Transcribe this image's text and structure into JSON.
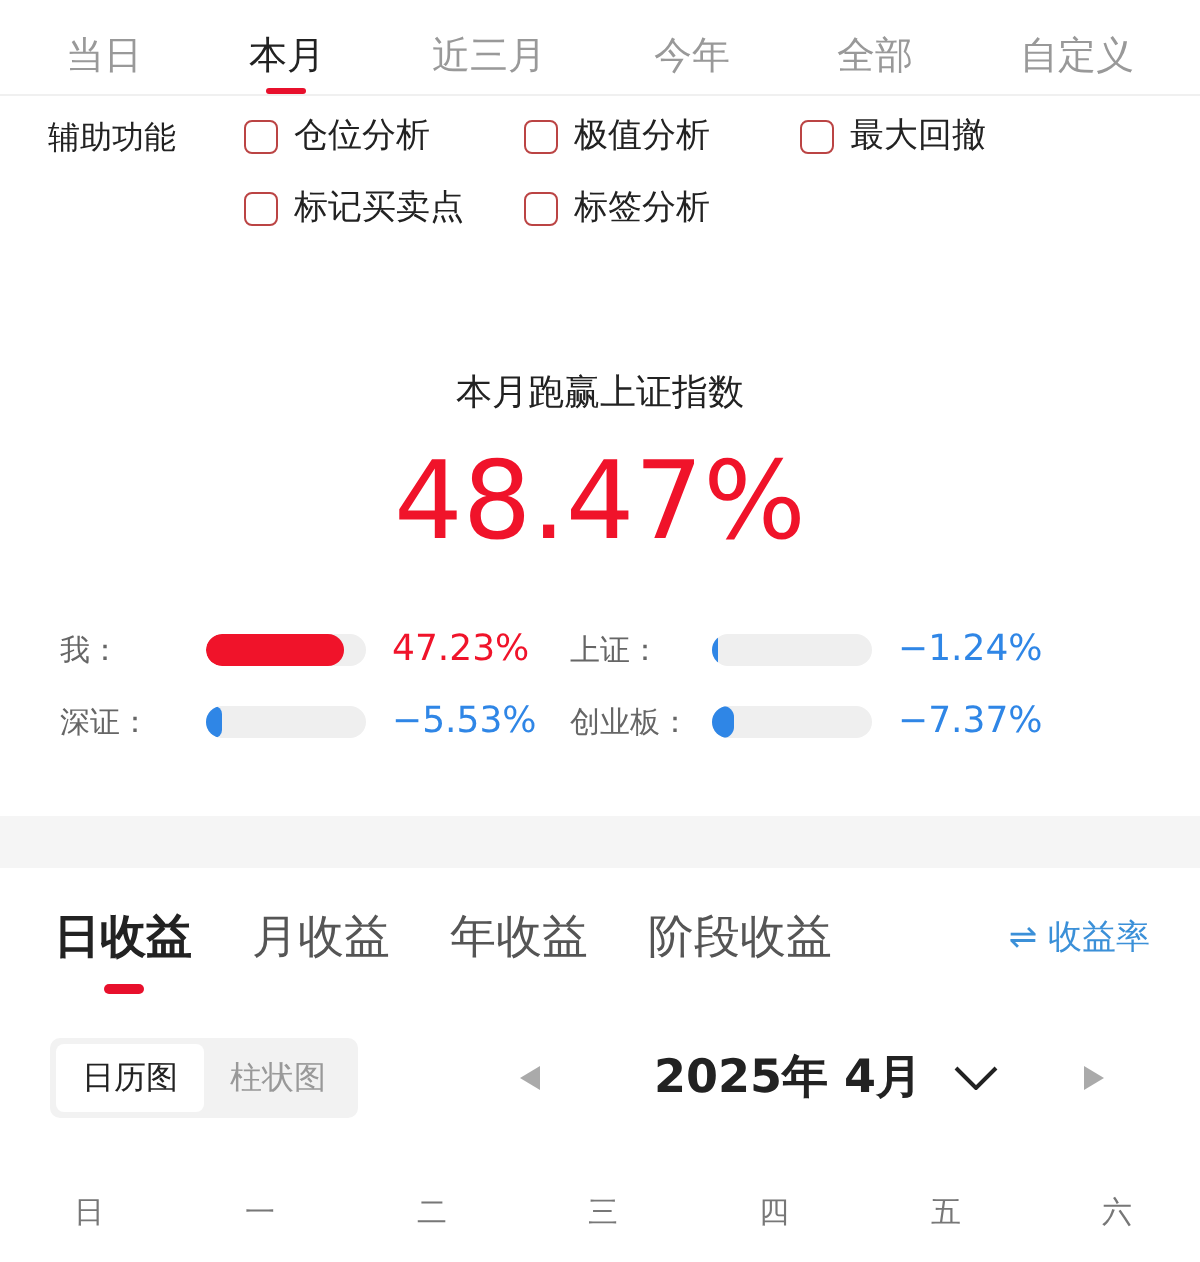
{
  "period_tabs": [
    {
      "label": "当日",
      "selected": false
    },
    {
      "label": "本月",
      "selected": true
    },
    {
      "label": "近三月",
      "selected": false
    },
    {
      "label": "今年",
      "selected": false
    },
    {
      "label": "全部",
      "selected": false
    },
    {
      "label": "自定义",
      "selected": false
    }
  ],
  "aux": {
    "label": "辅助功能",
    "options": [
      {
        "label": "仓位分析",
        "checked": false
      },
      {
        "label": "极值分析",
        "checked": false
      },
      {
        "label": "最大回撤",
        "checked": false
      },
      {
        "label": "标记买卖点",
        "checked": false
      },
      {
        "label": "标签分析",
        "checked": false
      }
    ]
  },
  "summary": {
    "title": "本月跑赢上证指数",
    "value": "48.47%"
  },
  "comparisons": [
    {
      "name": "我：",
      "level": 0.86,
      "reading": "47.23%",
      "color": "#f0132a"
    },
    {
      "name": "上证：",
      "level": 0.03,
      "reading": "−1.24%",
      "color": "#2f86e6"
    },
    {
      "name": "深证：",
      "level": 0.1,
      "reading": "−5.53%",
      "color": "#2f86e6"
    },
    {
      "name": "创业板：",
      "level": 0.14,
      "reading": "−7.37%",
      "color": "#2f86e6"
    }
  ],
  "profit_tabs": [
    {
      "label": "日收益",
      "selected": true
    },
    {
      "label": "月收益",
      "selected": false
    },
    {
      "label": "年收益",
      "selected": false
    },
    {
      "label": "阶段收益",
      "selected": false
    }
  ],
  "rate_link": {
    "icon": "⇌",
    "label": "收益率"
  },
  "view_toggle": [
    {
      "label": "日历图",
      "selected": true
    },
    {
      "label": "柱状图",
      "selected": false
    }
  ],
  "month": {
    "label": "2025年 4月"
  },
  "weekdays": [
    "日",
    "一",
    "二",
    "三",
    "四",
    "五",
    "六"
  ]
}
